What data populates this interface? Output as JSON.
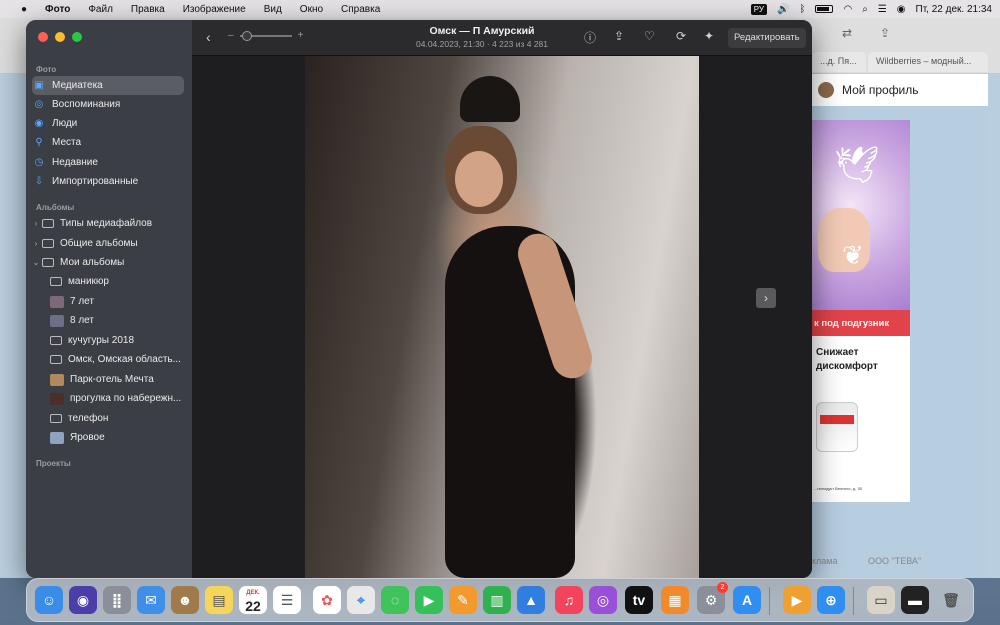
{
  "menubar": {
    "apple_icon": "",
    "items": [
      "Фото",
      "Файл",
      "Правка",
      "Изображение",
      "Вид",
      "Окно",
      "Справка"
    ],
    "input_lang": "РУ",
    "datetime": "Пт, 22 дек.  21:34"
  },
  "background_browser": {
    "tabs": [
      "...д. Пя...",
      "Wildberries – модный..."
    ],
    "profile_label": "Мой профиль",
    "ad": {
      "banner": "к под подгузник",
      "text_line1": "Снижает",
      "text_line2": "дискомфорт",
      "footer": "...ниподукт Велнесс, д. 35"
    },
    "footer_left": "клама",
    "footer_right": "ООО \"ТЕВА\""
  },
  "sidebar": {
    "section_photos": "Фото",
    "photos_items": [
      {
        "label": "Медиатека",
        "icon": "photo-library-icon",
        "selected": true
      },
      {
        "label": "Воспоминания",
        "icon": "memories-icon"
      },
      {
        "label": "Люди",
        "icon": "people-icon"
      },
      {
        "label": "Места",
        "icon": "places-icon"
      },
      {
        "label": "Недавние",
        "icon": "recent-icon"
      },
      {
        "label": "Импортированные",
        "icon": "imported-icon"
      }
    ],
    "section_albums": "Альбомы",
    "album_groups": [
      {
        "label": "Типы медиафайлов",
        "expanded": false
      },
      {
        "label": "Общие альбомы",
        "expanded": false
      },
      {
        "label": "Мои альбомы",
        "expanded": true
      }
    ],
    "my_albums": [
      {
        "label": "маникюр",
        "thumb": "folder"
      },
      {
        "label": "7 лет",
        "thumb": "#7d6a78"
      },
      {
        "label": "8 лет",
        "thumb": "#6c6f86"
      },
      {
        "label": "кучугуры 2018",
        "thumb": "folder"
      },
      {
        "label": "Омск, Омская область...",
        "thumb": "folder"
      },
      {
        "label": "Парк-отель Мечта",
        "thumb": "#b08a5c"
      },
      {
        "label": "прогулка по набережн...",
        "thumb": "#4a2f2a"
      },
      {
        "label": "телефон",
        "thumb": "folder"
      },
      {
        "label": "Яровое",
        "thumb": "#8ea3c0"
      }
    ],
    "section_projects": "Проекты"
  },
  "toolbar": {
    "title": "Омск — П Амурский",
    "subtitle": "04.04.2023, 21:30  ·  4 223 из 4 281",
    "edit_label": "Редактировать",
    "zoom_minus": "–",
    "zoom_plus": "+",
    "zoom_level": 0.05
  },
  "dock": {
    "calendar_month": "ДЕК.",
    "calendar_day": "22",
    "settings_badge": "2"
  },
  "colors": {
    "sidebar_bg": "#3b3e44",
    "accent": "#5aa9ff",
    "toolbar_bg": "#2b2b2d"
  }
}
